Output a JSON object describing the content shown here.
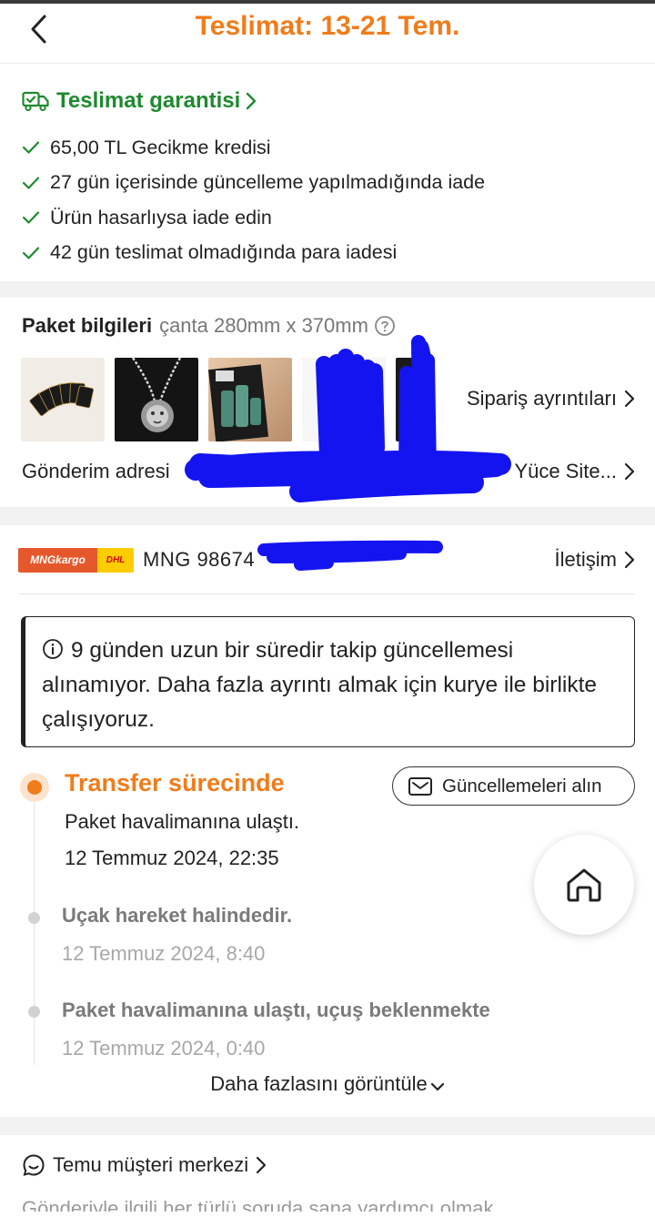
{
  "header": {
    "title": "Teslimat: 13-21 Tem.",
    "back_icon": "chevron-left-icon"
  },
  "guarantee": {
    "title": "Teslimat garantisi",
    "icon": "delivery-truck-check-icon",
    "items": [
      {
        "label": "65,00 TL Gecikme kredisi"
      },
      {
        "label": "27 gün içerisinde güncelleme yapılmadığında iade"
      },
      {
        "label": "Ürün hasarlıysa iade edin"
      },
      {
        "label": "42 gün teslimat olmadığında para iadesi"
      }
    ]
  },
  "package": {
    "title": "Paket bilgileri",
    "size": "çanta 280mm x 370mm",
    "order_details_label": "Sipariş ayrıntıları",
    "address_label": "Gönderim adresi",
    "address_value": "Yüce Site..."
  },
  "shipping": {
    "carrier_logo_mng": "MNGkargo",
    "carrier_logo_dhl": "DHL",
    "tracking": "MNG 98674",
    "contact_label": "İletişim",
    "notice": "9 günden uzun bir süredir takip güncellemesi alınamıyor. Daha fazla ayrıntı almak için kurye ile birlikte çalışıyoruz.",
    "updates_button": "Güncellemeleri alın",
    "timeline": [
      {
        "status": "Transfer sürecinde",
        "desc": "Paket havalimanına ulaştı.",
        "date": "12 Temmuz 2024, 22:35"
      },
      {
        "desc": "Uçak hareket halindedir.",
        "date": "12 Temmuz 2024, 8:40"
      },
      {
        "desc": "Paket havalimanına ulaştı, uçuş beklenmekte",
        "date": "12 Temmuz 2024, 0:40"
      }
    ],
    "more_label": "Daha fazlasını görüntüle"
  },
  "support": {
    "title": "Temu müşteri merkezi",
    "subtitle": "Gönderiyle ilgili her türlü soruda sana yardımcı olmak"
  },
  "colors": {
    "accent": "#f07c1b",
    "guarantee_green": "#1e8a2e",
    "redaction_blue": "#1414f0"
  }
}
